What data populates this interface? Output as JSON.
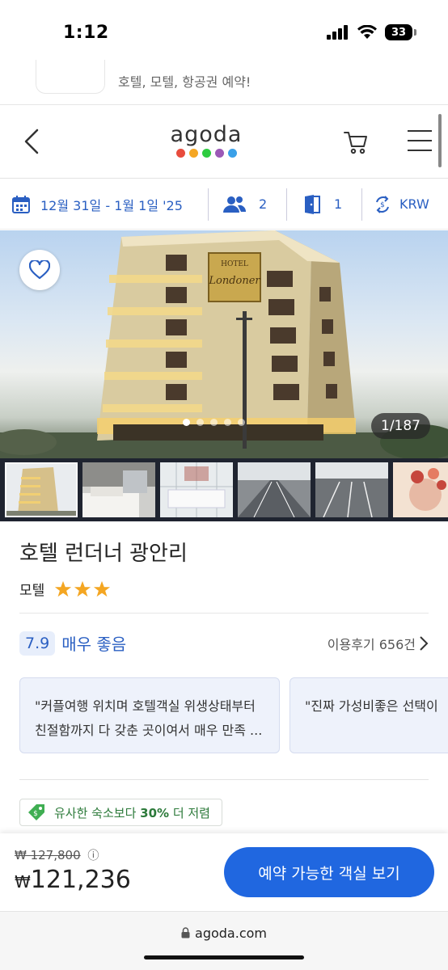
{
  "status": {
    "time": "1:12",
    "battery": "33"
  },
  "app_banner": {
    "text": "호텔, 모텔, 항공권 예약!"
  },
  "header": {
    "logo": "agoda",
    "logo_dot_colors": [
      "#e84c3d",
      "#f5a623",
      "#2ecc40",
      "#9b59b6",
      "#3aa0e8"
    ]
  },
  "search": {
    "dates": "12월 31일 - 1월 1일 '25",
    "guests": "2",
    "rooms": "1",
    "currency": "KRW"
  },
  "gallery": {
    "counter": "1/187",
    "sign_top": "HOTEL",
    "sign_name": "Londoner",
    "thumbnails": [
      "building",
      "bedroom",
      "bathroom",
      "parking",
      "parking-lot",
      "flowers"
    ]
  },
  "hotel": {
    "name": "호텔 런더너 광안리",
    "type": "모텔",
    "stars": 3
  },
  "rating": {
    "score": "7.9",
    "label": "매우 좋음",
    "reviews_link": "이용후기 656건"
  },
  "reviews": [
    {
      "line1": "\"커플여행 위치며 호텔객실 위생상태부터",
      "line2": "친절함까지 다 갖춘 곳이여서 매우 만족 ..."
    },
    {
      "line1": "\"진짜 가성비좋은 선택이",
      "line2": ""
    }
  ],
  "deal": {
    "prefix": "유사한 숙소보다 ",
    "pct": "30%",
    "suffix": " 더 저렴"
  },
  "booking": {
    "old_price": "₩ 127,800",
    "info_icon": "ⓘ",
    "currency": "₩",
    "price": "121,236",
    "cta": "예약 가능한 객실 보기"
  },
  "browser": {
    "url": "agoda.com"
  }
}
